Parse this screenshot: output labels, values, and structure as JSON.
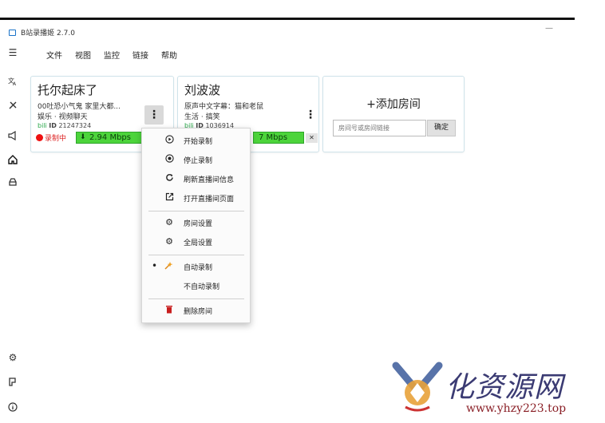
{
  "window": {
    "title": "B站录播姬 2.7.0",
    "minimize": "—"
  },
  "menu": [
    "文件",
    "视图",
    "监控",
    "链接",
    "帮助"
  ],
  "sidebar": {
    "top": [
      "hamburger-icon",
      "translate-icon",
      "tools-icon",
      "megaphone-icon",
      "home-icon",
      "drive-icon"
    ],
    "bottom": [
      "settings-icon",
      "logo-icon",
      "info-icon"
    ]
  },
  "rooms": [
    {
      "name": "托尔起床了",
      "title": "00吐恐小气鬼 家里大都...",
      "area": "娱乐 · 视频聊天",
      "platform": "bili",
      "id_label": "ID",
      "room_id": "21247324",
      "status": "录制中",
      "rate": "2.94 Mbps"
    },
    {
      "name": "刘波波",
      "title": "原声中文字幕：猫和老鼠",
      "area": "生活 · 搞笑",
      "platform": "bili",
      "id_label": "ID",
      "room_id": "1036914",
      "rate": "7 Mbps",
      "close": "✕"
    }
  ],
  "add_room": {
    "title": "+添加房间",
    "placeholder": "房间号或房间链接",
    "confirm": "确定"
  },
  "context_menu": {
    "items": [
      {
        "icon": "play-circle-icon",
        "label": "开始录制"
      },
      {
        "icon": "stop-circle-icon",
        "label": "停止录制"
      },
      {
        "icon": "refresh-icon",
        "label": "刷新直播间信息"
      },
      {
        "icon": "open-external-icon",
        "label": "打开直播间页面"
      },
      {
        "icon": "gear-icon",
        "label": "房间设置"
      },
      {
        "icon": "gear-icon",
        "label": "全局设置"
      },
      {
        "icon": "auto-record-icon",
        "label": "自动录制",
        "checked": true
      },
      {
        "icon": "",
        "label": "不自动录制"
      },
      {
        "icon": "trash-icon",
        "label": "删除房间"
      }
    ]
  },
  "watermark": {
    "text": "化资源网",
    "url": "www.yhzy223.top"
  }
}
